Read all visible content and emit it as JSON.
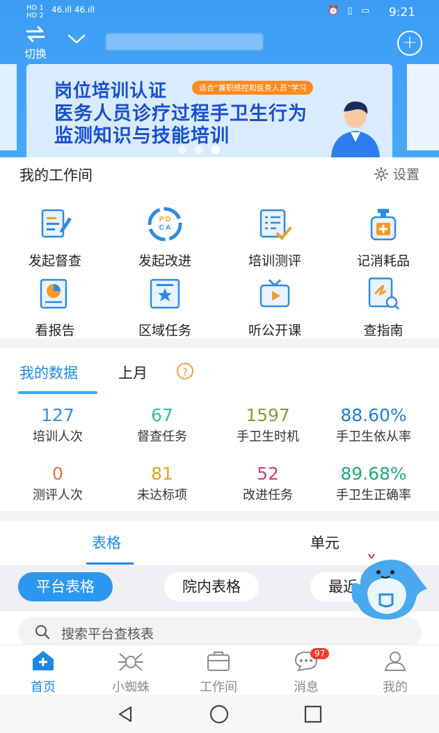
{
  "status_bar": {
    "left_top": "HD 1",
    "left_bottom": "HD 2",
    "signal": "46.ıll 46.ıll",
    "time": "9:21"
  },
  "header": {
    "switch_label": "切换"
  },
  "banner": {
    "title": "岗位培训认证",
    "tag": "适合“兼职感控和医务人员”学习",
    "subtitle_line1": "医务人员诊疗过程手卫生行为",
    "subtitle_line2": "监测知识与技能培训",
    "active_slide": 3,
    "slide_count": 3
  },
  "workbench": {
    "title": "我的工作间",
    "settings_label": "设置",
    "items": [
      {
        "label": "发起督查",
        "icon": "clipboard-edit-icon"
      },
      {
        "label": "发起改进",
        "icon": "pdca-icon"
      },
      {
        "label": "培训测评",
        "icon": "checklist-icon"
      },
      {
        "label": "记消耗品",
        "icon": "sanitizer-bottle-icon"
      },
      {
        "label": "看报告",
        "icon": "report-chart-icon"
      },
      {
        "label": "区域任务",
        "icon": "star-banner-icon"
      },
      {
        "label": "听公开课",
        "icon": "tv-play-icon"
      },
      {
        "label": "查指南",
        "icon": "guide-search-icon"
      }
    ]
  },
  "data_panel": {
    "tab_active": "我的数据",
    "tab_period": "上月",
    "help_icon": "?",
    "stats": [
      {
        "value": "127",
        "label": "培训人次",
        "color": "#3c8fd9"
      },
      {
        "value": "67",
        "label": "督查任务",
        "color": "#35b9a3"
      },
      {
        "value": "1597",
        "label": "手卫生时机",
        "color": "#8a9a3a"
      },
      {
        "value": "88.60%",
        "label": "手卫生依从率",
        "color": "#1e7fd6"
      },
      {
        "value": "0",
        "label": "测评人次",
        "color": "#e8713c"
      },
      {
        "value": "81",
        "label": "未达标项",
        "color": "#e1a71f"
      },
      {
        "value": "52",
        "label": "改进任务",
        "color": "#c9466e"
      },
      {
        "value": "89.68%",
        "label": "手卫生正确率",
        "color": "#22a77a"
      }
    ]
  },
  "tables": {
    "tab_table": "表格",
    "tab_unit": "单元",
    "chips": [
      "平台表格",
      "院内表格",
      "最近"
    ],
    "search_placeholder": "搜索平台查核表"
  },
  "bottom_nav": {
    "items": [
      {
        "label": "首页",
        "icon": "home-icon"
      },
      {
        "label": "小蜘蛛",
        "icon": "spider-icon"
      },
      {
        "label": "工作间",
        "icon": "toolbox-icon"
      },
      {
        "label": "消息",
        "icon": "chat-bubble-icon"
      },
      {
        "label": "我的",
        "icon": "user-icon"
      }
    ],
    "message_badge": "97"
  },
  "colors": {
    "primary": "#1e88e5",
    "header": "#42a5f5"
  }
}
